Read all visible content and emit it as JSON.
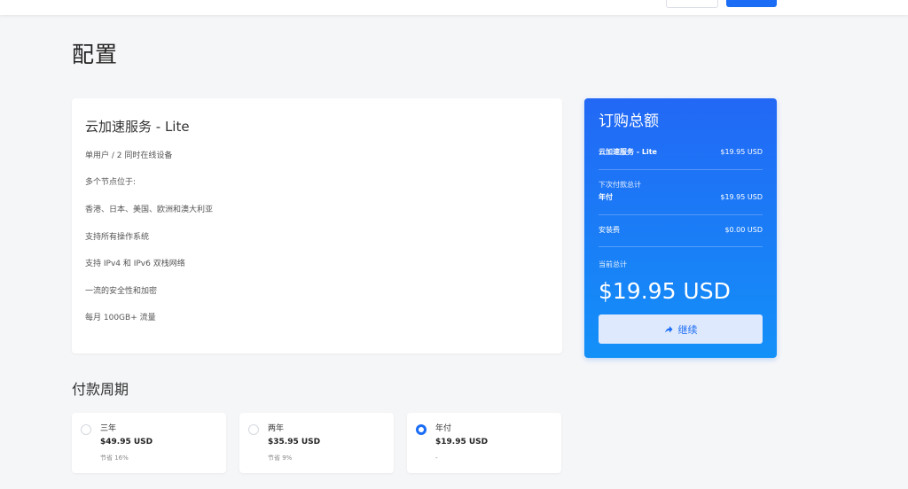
{
  "page": {
    "title": "配置"
  },
  "product": {
    "name": "云加速服务 - Lite",
    "features": [
      "单用户 / 2 同时在线设备",
      "多个节点位于:",
      "香港、日本、美国、欧洲和澳大利亚",
      "支持所有操作系统",
      "支持 IPv4 和 IPv6 双栈网络",
      "一流的安全性和加密",
      "每月 100GB+ 流量"
    ]
  },
  "summary": {
    "title": "订购总额",
    "product_label": "云加速服务 - Lite",
    "product_price": "$19.95 USD",
    "next_payment_label": "下次付款总计",
    "cycle_label": "年付",
    "cycle_price": "$19.95 USD",
    "setup_label": "安装费",
    "setup_price": "$0.00 USD",
    "current_total_label": "当前总计",
    "total": "$19.95 USD",
    "continue_label": "继续"
  },
  "billing": {
    "title": "付款周期",
    "options": [
      {
        "name": "三年",
        "price": "$49.95 USD",
        "saving": "节省 16%",
        "selected": false
      },
      {
        "name": "两年",
        "price": "$35.95 USD",
        "saving": "节省 9%",
        "selected": false
      },
      {
        "name": "年付",
        "price": "$19.95 USD",
        "saving": "-",
        "selected": true
      }
    ]
  },
  "colors": {
    "accent": "#1b6df5",
    "summary_gradient_top": "#2268f5",
    "summary_gradient_bottom": "#1390f8"
  },
  "icons": {
    "continue": "arrow-forward-icon",
    "radio": "radio-icon"
  }
}
